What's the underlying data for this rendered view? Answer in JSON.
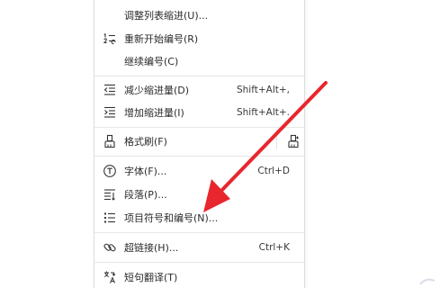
{
  "menu": {
    "items": [
      {
        "label": "调整列表缩进(U)...",
        "shortcut": "",
        "icon": "none"
      },
      {
        "label": "重新开始编号(R)",
        "shortcut": "",
        "icon": "restart-numbering-icon"
      },
      {
        "label": "继续编号(C)",
        "shortcut": "",
        "icon": "none"
      },
      {
        "label": "减少缩进量(D)",
        "shortcut": "Shift+Alt+,",
        "icon": "decrease-indent-icon"
      },
      {
        "label": "增加缩进量(I)",
        "shortcut": "Shift+Alt+.",
        "icon": "increase-indent-icon"
      },
      {
        "label": "格式刷(F)",
        "shortcut": "",
        "icon": "format-painter-icon"
      },
      {
        "label": "字体(F)...",
        "shortcut": "Ctrl+D",
        "icon": "font-icon"
      },
      {
        "label": "段落(P)...",
        "shortcut": "",
        "icon": "paragraph-icon"
      },
      {
        "label": "项目符号和编号(N)...",
        "shortcut": "",
        "icon": "bullets-numbering-icon"
      },
      {
        "label": "超链接(H)...",
        "shortcut": "Ctrl+K",
        "icon": "hyperlink-icon"
      },
      {
        "label": "短句翻译(T)",
        "shortcut": "",
        "icon": "translate-icon"
      }
    ]
  },
  "colors": {
    "arrow": "#e8262d",
    "menu_text": "#2b2b2b",
    "separator": "#e6e6e6"
  }
}
